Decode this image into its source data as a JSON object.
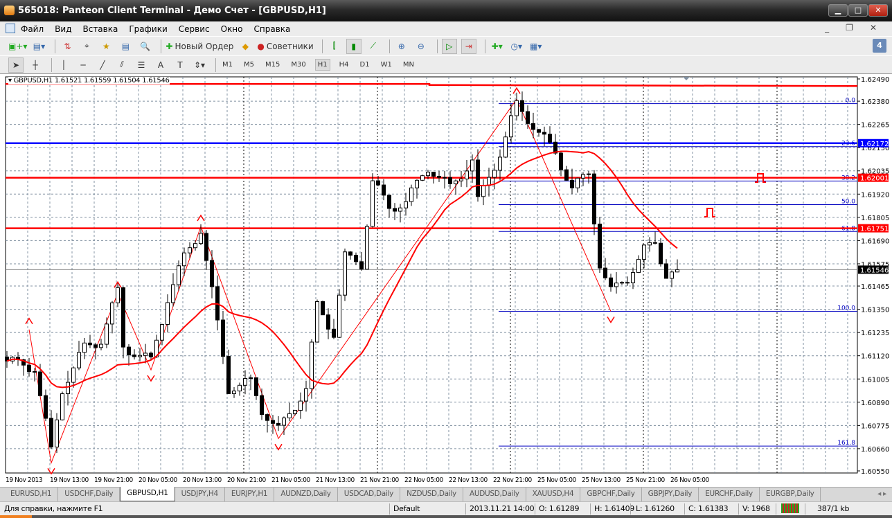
{
  "window": {
    "title": "565018: Panteon Client Terminal - Демо Счет - [GBPUSD,H1]"
  },
  "menu": [
    "Файл",
    "Вид",
    "Вставка",
    "Графики",
    "Сервис",
    "Окно",
    "Справка"
  ],
  "toolbar": {
    "new_order": "Новый Ордер",
    "experts": "Советники",
    "notifications": "4"
  },
  "timeframes": [
    "M1",
    "M5",
    "M15",
    "M30",
    "H1",
    "H4",
    "D1",
    "W1",
    "MN"
  ],
  "active_timeframe": "H1",
  "chart_header": "GBPUSD,H1  1.61521 1.61559 1.61504 1.61546",
  "chart_data": {
    "type": "candlestick",
    "symbol": "GBPUSD",
    "timeframe": "H1",
    "ylim": [
      1.6055,
      1.6249
    ],
    "price_ticks": [
      "1.62490",
      "1.62380",
      "1.62265",
      "1.62150",
      "1.62035",
      "1.61920",
      "1.61805",
      "1.61690",
      "1.61575",
      "1.61465",
      "1.61350",
      "1.61235",
      "1.61120",
      "1.61005",
      "1.60890",
      "1.60775",
      "1.60660",
      "1.60550"
    ],
    "time_labels": [
      "19 Nov 2013",
      "19 Nov 13:00",
      "19 Nov 21:00",
      "20 Nov 05:00",
      "20 Nov 13:00",
      "20 Nov 21:00",
      "21 Nov 05:00",
      "21 Nov 13:00",
      "21 Nov 21:00",
      "22 Nov 05:00",
      "22 Nov 13:00",
      "22 Nov 21:00",
      "25 Nov 05:00",
      "25 Nov 13:00",
      "25 Nov 21:00",
      "26 Nov 05:00"
    ],
    "bar_count": 122,
    "price_path": [
      [
        0,
        1.61094
      ],
      [
        5,
        1.6106
      ],
      [
        8,
        1.60648
      ],
      [
        10,
        1.60957
      ],
      [
        14,
        1.61163
      ],
      [
        17,
        1.61197
      ],
      [
        20,
        1.61437
      ],
      [
        21,
        1.61163
      ],
      [
        26,
        1.61094
      ],
      [
        29,
        1.61403
      ],
      [
        32,
        1.61609
      ],
      [
        35,
        1.61746
      ],
      [
        37,
        1.61437
      ],
      [
        40,
        1.60957
      ],
      [
        44,
        1.60991
      ],
      [
        46,
        1.60854
      ],
      [
        49,
        1.60751
      ],
      [
        54,
        1.60957
      ],
      [
        56,
        1.61368
      ],
      [
        59,
        1.61231
      ],
      [
        61,
        1.61609
      ],
      [
        64,
        1.61574
      ],
      [
        66,
        1.61986
      ],
      [
        69,
        1.61849
      ],
      [
        72,
        1.61883
      ],
      [
        76,
        1.62054
      ],
      [
        80,
        1.61951
      ],
      [
        84,
        1.62089
      ],
      [
        85,
        1.61883
      ],
      [
        89,
        1.62123
      ],
      [
        92,
        1.62363
      ],
      [
        95,
        1.6226
      ],
      [
        99,
        1.62123
      ],
      [
        102,
        1.61951
      ],
      [
        105,
        1.6202
      ],
      [
        107,
        1.61574
      ],
      [
        109,
        1.61437
      ],
      [
        112,
        1.61506
      ],
      [
        115,
        1.61643
      ],
      [
        117,
        1.61677
      ],
      [
        119,
        1.61523
      ],
      [
        121,
        1.61546
      ]
    ],
    "zigzag": [
      [
        4,
        1.6125
      ],
      [
        8,
        1.6059
      ],
      [
        20,
        1.6143
      ],
      [
        26,
        1.6105
      ],
      [
        35,
        1.6176
      ],
      [
        49,
        1.6071
      ],
      [
        92,
        1.6239
      ],
      [
        109,
        1.6134
      ]
    ],
    "ma_period": 20,
    "last_price": "1.61546",
    "levels": [
      {
        "price": 1.62172,
        "label": "1.62172",
        "color": "#0000ff"
      },
      {
        "price": 1.62001,
        "label": "1.62001",
        "color": "#ff0000"
      },
      {
        "price": 1.61751,
        "label": "1.61751",
        "color": "#ff0000"
      }
    ],
    "top_line_price": 1.6246,
    "fibo": {
      "start_index": 89,
      "levels": [
        {
          "label": "0.0",
          "price": 1.62368
        },
        {
          "label": "23.6",
          "price": 1.62155
        },
        {
          "label": "38.2",
          "price": 1.61985
        },
        {
          "label": "50.0",
          "price": 1.61868
        },
        {
          "label": "61.8",
          "price": 1.61735
        },
        {
          "label": "100.0",
          "price": 1.6134
        },
        {
          "label": "161.8",
          "price": 1.60673
        }
      ]
    }
  },
  "tabs": [
    "EURUSD,H1",
    "USDCHF,Daily",
    "GBPUSD,H1",
    "USDJPY,H4",
    "EURJPY,H1",
    "AUDNZD,Daily",
    "USDCAD,Daily",
    "NZDUSD,Daily",
    "AUDUSD,Daily",
    "XAUUSD,H4",
    "GBPCHF,Daily",
    "GBPJPY,Daily",
    "EURCHF,Daily",
    "EURGBP,Daily"
  ],
  "active_tab": "GBPUSD,H1",
  "status": {
    "help": "Для справки, нажмите F1",
    "profile": "Default",
    "time": "2013.11.21 14:00",
    "open": "O: 1.61289",
    "high": "H: 1.61409",
    "low": "L: 1.61260",
    "close": "C: 1.61383",
    "volume": "V: 1968",
    "traffic": "387/1 kb"
  },
  "colors": {
    "bull": "#ffffff",
    "bear": "#000000",
    "ma": "#ff0000",
    "fibo": "#0000c0",
    "grid": "#708090"
  }
}
